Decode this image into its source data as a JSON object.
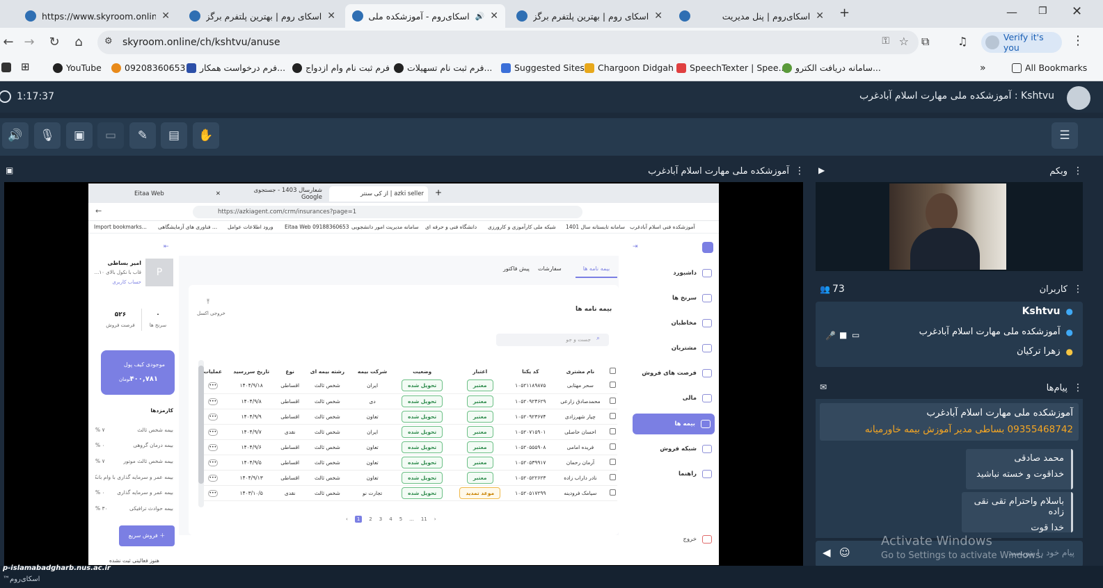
{
  "browser": {
    "tabs": [
      {
        "title": "https://www.skyroom.online/ch",
        "active": false
      },
      {
        "title": "اسکای روم | بهترین پلتفرم برگزاری",
        "active": false
      },
      {
        "title": "اسکای‌روم - آموزشکده ملی مه",
        "active": true
      },
      {
        "title": "اسکای روم | بهترین پلتفرم برگزاری",
        "active": false
      },
      {
        "title": "اسکای‌روم | پنل مدیریت",
        "active": false
      }
    ],
    "url": "skyroom.online/ch/kshtvu/anuse",
    "verify_label": "Verify it's you",
    "bookmarks": [
      "YouTube",
      "09208360653",
      "فرم درخواست همکار...",
      "فرم ثبت نام وام ازدواج",
      "فرم ثبت نام تسهیلات...",
      "Suggested Sites",
      "Chargoon Didgah",
      "SpeechTexter | Spee...",
      "سامانه دریافت الکترو..."
    ],
    "all_bookmarks": "All Bookmarks"
  },
  "room": {
    "timer": "1:17:37",
    "title": "Kshtvu : آموزشکده ملی مهارت اسلام آبادغرب",
    "screen_panel_title": "آموزشکده ملی مهارت اسلام آبادغرب",
    "webcam_title": "وبکم",
    "users_title": "کاربران",
    "users_count": "73",
    "users": [
      "Kshtvu",
      "آموزشکده ملی مهارت اسلام آبادغرب",
      "زهرا ترکیان"
    ],
    "messages_title": "پیام‌ها",
    "messages": [
      {
        "line1": "آموزشکده ملی مهارت اسلام آبادغرب",
        "line2": "09355468742 بساطی مدیر آموزش بیمه خاورمیانه"
      },
      {
        "line1": "محمد صادقی",
        "line2": "خداقوت و خسته نباشید"
      },
      {
        "line1": "باسلام واحترام تقی نقی زاده",
        "line2": "خدا قوت"
      }
    ],
    "chat_placeholder": "پیام خود را بنویسید",
    "watermark_title": "Activate Windows",
    "watermark_sub": "Go to Settings to activate Windows.",
    "status_domain": "p-islamabadgharb.nus.ac.ir",
    "status_brand": "™اسکای‌روم"
  },
  "inner": {
    "tabs": [
      "Eitaa Web",
      "شعارسال 1403 - جستجوی Google",
      "azki seller | از کی سنتر"
    ],
    "url": "https://azkiagent.com/crm/insurances?page=1",
    "bookmarks": [
      "Import bookmarks...",
      "فناوری های آزمایشگاهی ...",
      "ورود اطلاعات عوامل",
      "Eitaa Web 09188360653",
      "سامانه مدیریت امور دانشجویی",
      "دانشگاه فنی و حرفه ای",
      "شبکه ملی کارآموزی و کارورزی",
      "سامانه تابستانه سال 1401",
      "آموزشکده فنی اسلام آبادغرب"
    ],
    "sidebar": [
      "داشبورد",
      "سرنخ ها",
      "مخاطبان",
      "مشتریان",
      "فرصت های فروش",
      "مالی",
      "بیمه ها",
      "شبکه فروش",
      "راهنما"
    ],
    "logout": "خروج",
    "page_tabs": [
      "بیمه نامه ها",
      "سفارشات",
      "پیش فاکتور"
    ],
    "section_title": "بیمه نامه ها",
    "export_label": "خروجی اکسل",
    "search_placeholder": "جست و جو",
    "columns": [
      "نام مشتری",
      "کد یکتا",
      "اعتبار",
      "وضعیت",
      "شرکت بیمه",
      "رشته بیمه ای",
      "نوع",
      "تاریخ سررسید",
      "عملیات"
    ],
    "rows": [
      [
        "سحر مهتابی",
        "۱۰۵۲۱۱۸۹۸۷۵",
        "معتبر",
        "تحویل شده",
        "ایران",
        "شخص ثالث",
        "اقساطی",
        "۱۴۰۴/۹/۱۸"
      ],
      [
        "محمدصادق زارعی",
        "۱۰۵۲۰۹۲۴۶۲۹",
        "معتبر",
        "تحویل شده",
        "دی",
        "شخص ثالث",
        "اقساطی",
        "۱۴۰۴/۹/۸"
      ],
      [
        "چیار شهرزادی",
        "۱۰۵۲۰۹۲۳۶۷۴",
        "معتبر",
        "تحویل شده",
        "تعاون",
        "شخص ثالث",
        "اقساطی",
        "۱۴۰۴/۹/۹"
      ],
      [
        "احسان حاصلی",
        "۱۰۵۲۰۷۱۵۹۰۱",
        "معتبر",
        "تحویل شده",
        "ایران",
        "شخص ثالث",
        "نقدی",
        "۱۴۰۴/۹/۷"
      ],
      [
        "فریده امامی",
        "۱۰۵۲۰۵۵۵۹۰۸",
        "معتبر",
        "تحویل شده",
        "تعاون",
        "شخص ثالث",
        "اقساطی",
        "۱۴۰۴/۹/۶"
      ],
      [
        "آرمان رحمان",
        "۱۰۵۲۰۵۳۹۹۱۷",
        "معتبر",
        "تحویل شده",
        "تعاون",
        "شخص ثالث",
        "اقساطی",
        "۱۴۰۴/۹/۵"
      ],
      [
        "نادر داراب زاده",
        "۱۰۵۲۰۵۲۲۶۲۳",
        "معتبر",
        "تحویل شده",
        "تعاون",
        "شخص ثالث",
        "اقساطی",
        "۱۴۰۴/۹/۱۳"
      ],
      [
        "سیامک فرودینه",
        "۱۰۵۲۰۵۱۷۲۹۹",
        "موعد تمدید",
        "تحویل شده",
        "تجارت نو",
        "شخص ثالث",
        "نقدی",
        "۱۴۰۳/۱۰/۵"
      ]
    ],
    "pages": [
      "1",
      "2",
      "3",
      "4",
      "5",
      "...",
      "11"
    ],
    "profile": {
      "name": "امیر بساطی",
      "avatar": "P",
      "sub1": "قاب با نکول بالای ۱۰...",
      "sub2": "حساب کاربری",
      "stat1_value": "۵۲۶",
      "stat1_label": "فرصت فروش",
      "stat2_value": "۰",
      "stat2_label": "سرنخ ها"
    },
    "wallet": {
      "label": "موجودی کیف پول",
      "amount": "۴۰۰,۷۸۱",
      "unit": "تومان"
    },
    "commissions_title": "کارمزدها",
    "commissions": [
      {
        "label": "بیمه شخص ثالث",
        "value": "۷ %"
      },
      {
        "label": "بیمه درمان گروهی",
        "value": "۰ %"
      },
      {
        "label": "بیمه شخص ثالث موتور",
        "value": "۷ %"
      },
      {
        "label": "بیمه عمر و سرمایه گذاری با وام بانکی",
        "value": ""
      },
      {
        "label": "بیمه عمر و سرمایه گذاری",
        "value": "۰ %"
      },
      {
        "label": "بیمه حوادث ترافیکی",
        "value": "۳۰ %"
      }
    ],
    "quick_sale": "فروش سریع",
    "no_activity": "هنوز فعالیتی ثبت نشده"
  }
}
